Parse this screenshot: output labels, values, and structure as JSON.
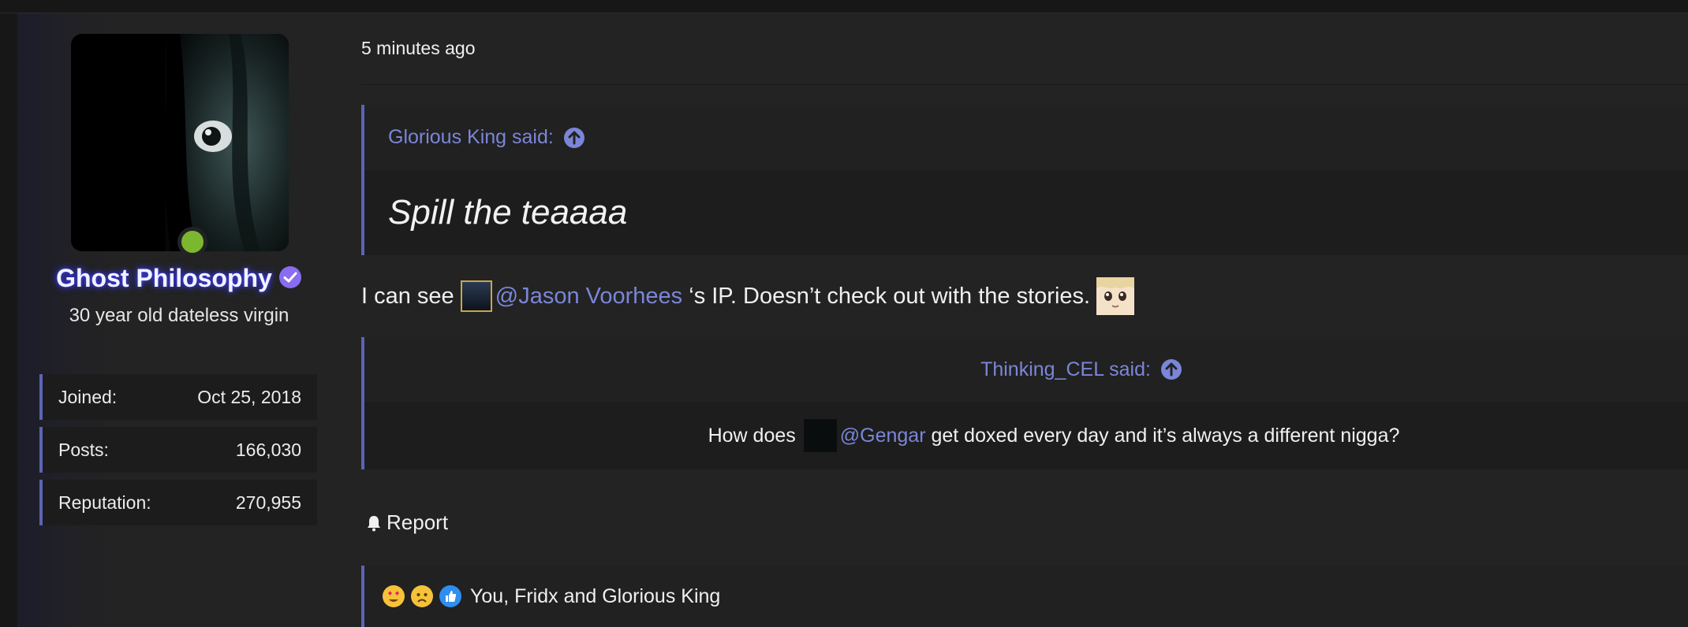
{
  "user": {
    "name": "Ghost Philosophy",
    "title": "30 year old dateless virgin",
    "stats": [
      {
        "label": "Joined:",
        "value": "Oct 25, 2018"
      },
      {
        "label": "Posts:",
        "value": "166,030"
      },
      {
        "label": "Reputation:",
        "value": "270,955"
      }
    ]
  },
  "post": {
    "timestamp": "5 minutes ago",
    "quote1": {
      "author": "Glorious King said:",
      "text": "Spill the teaaaa"
    },
    "body": {
      "prefix": "I can see",
      "mention": "@Jason Voorhees",
      "suffix": "‘s IP. Doesn’t check out with the stories."
    },
    "quote2": {
      "author": "Thinking_CEL said:",
      "prefix": "How does",
      "mention": "@Gengar",
      "suffix": "get doxed every day and it’s always a different nigga?"
    },
    "report_label": "Report",
    "reactions_text": "You, Fridx and Glorious King"
  },
  "colors": {
    "accent": "#5c64b4",
    "link": "#7b86d8",
    "online": "#7cb82f"
  }
}
